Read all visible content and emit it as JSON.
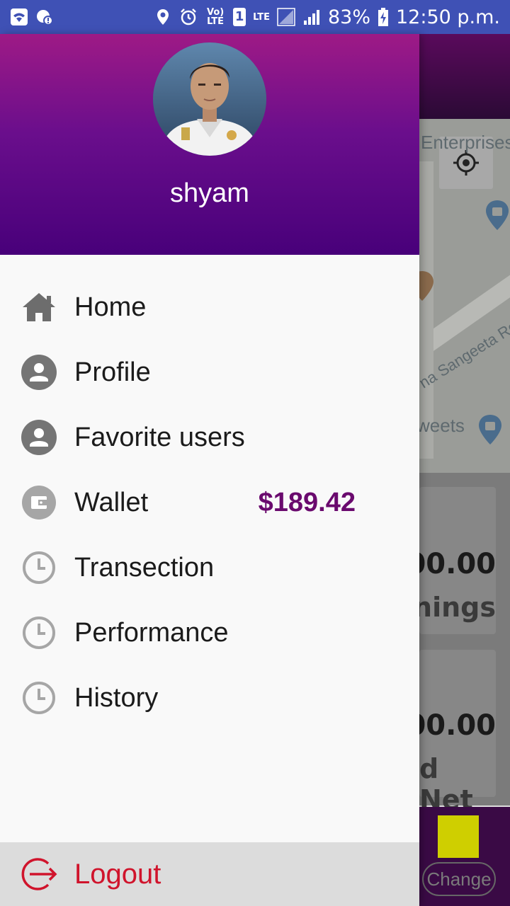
{
  "status_bar": {
    "battery": "83%",
    "time": "12:50 p.m.",
    "sim_slot": "1",
    "volte_label": "Vo) LTE",
    "lte_label": "LTE"
  },
  "drawer": {
    "username": "shyam",
    "items": [
      {
        "label": "Home",
        "icon": "home-icon"
      },
      {
        "label": "Profile",
        "icon": "person-icon"
      },
      {
        "label": "Favorite users",
        "icon": "person-icon"
      },
      {
        "label": "Wallet",
        "icon": "wallet-icon",
        "value": "$189.42"
      },
      {
        "label": "Transection",
        "icon": "clock-icon"
      },
      {
        "label": "Performance",
        "icon": "clock-icon"
      },
      {
        "label": "History",
        "icon": "clock-icon"
      }
    ],
    "logout_label": "Logout"
  },
  "background": {
    "map_text_1": "Enterprises",
    "map_text_2": "na Sangeeta Rd",
    "map_text_3": "weets",
    "card1_value": "00.00",
    "card1_sub": "nings",
    "card2_value": "00.00",
    "card2_sub": "d Net",
    "change_button": "Change"
  },
  "colors": {
    "status_bar": "#3f51b5",
    "header_top": "#9e1a86",
    "header_bottom": "#48007a",
    "wallet_value": "#6a0a6e",
    "logout": "#d0142c"
  }
}
